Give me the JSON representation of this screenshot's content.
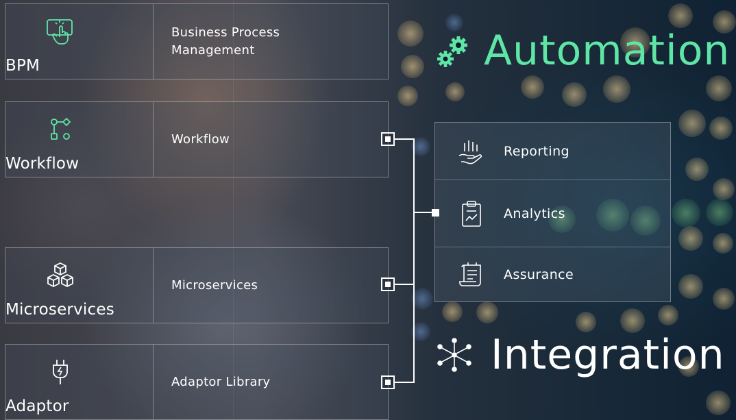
{
  "cards": [
    {
      "name": "BPM",
      "description": "Business Process Management",
      "icon": "touch-screen-icon"
    },
    {
      "name": "Workflow",
      "description": "Workflow",
      "icon": "workflow-nodes-icon"
    },
    {
      "name": "Microservices",
      "description": "Microservices",
      "icon": "cubes-icon"
    },
    {
      "name": "Adaptor",
      "description": "Adaptor Library",
      "icon": "plug-icon"
    }
  ],
  "panel": {
    "items": [
      {
        "label": "Reporting",
        "icon": "hand-bars-icon"
      },
      {
        "label": "Analytics",
        "icon": "clipboard-chart-icon"
      },
      {
        "label": "Assurance",
        "icon": "scroll-document-icon"
      }
    ]
  },
  "headings": {
    "automation": {
      "text": "Automation",
      "icon": "gears-icon",
      "color": "#5ee6a6"
    },
    "integration": {
      "text": "Integration",
      "icon": "network-nodes-icon",
      "color": "#ffffff"
    }
  },
  "colors": {
    "accent": "#5ee6a6",
    "text": "#ffffff"
  }
}
